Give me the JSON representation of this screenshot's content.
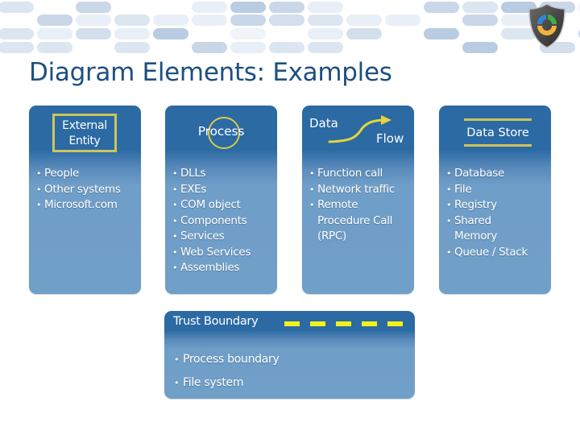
{
  "header": {
    "banner_icon": "shield-refresh-logo-icon"
  },
  "page_title": "Diagram Elements: Examples",
  "elements": [
    {
      "id": "external-entity",
      "symbol": "rectangle",
      "title_lines": [
        "External",
        "Entity"
      ],
      "items": [
        {
          "text": "People"
        },
        {
          "text": "Other systems"
        },
        {
          "text": "Microsoft.com"
        }
      ]
    },
    {
      "id": "process",
      "symbol": "circle",
      "title": "Process",
      "items": [
        {
          "text": "DLLs"
        },
        {
          "text": "EXEs"
        },
        {
          "text": "COM object"
        },
        {
          "text": "Components"
        },
        {
          "text": "Services"
        },
        {
          "text": "Web Services"
        },
        {
          "text": "Assemblies"
        }
      ]
    },
    {
      "id": "data-flow",
      "symbol": "curved-arrow",
      "title_parts": [
        "Data",
        "Flow"
      ],
      "items": [
        {
          "text": "Function call"
        },
        {
          "text": "Network traffic"
        },
        {
          "text": "Remote",
          "cont": "Procedure Call",
          "cont2": "(RPC)"
        }
      ]
    },
    {
      "id": "data-store",
      "symbol": "parallel-lines",
      "title": "Data Store",
      "items": [
        {
          "text": "Database"
        },
        {
          "text": "File"
        },
        {
          "text": "Registry"
        },
        {
          "text": "Shared",
          "cont": "Memory"
        },
        {
          "text": "Queue / Stack"
        }
      ]
    }
  ],
  "trust_boundary": {
    "symbol": "dashed-line",
    "title": "Trust Boundary",
    "items": [
      {
        "text": "Process boundary"
      },
      {
        "text": "File system"
      }
    ]
  },
  "colors": {
    "title": "#1d4f80",
    "card_top": "#2c6aa3",
    "card_bottom": "#709fc8",
    "symbol_outline": "#cdc45b",
    "boundary_dash": "#f2f21a"
  }
}
